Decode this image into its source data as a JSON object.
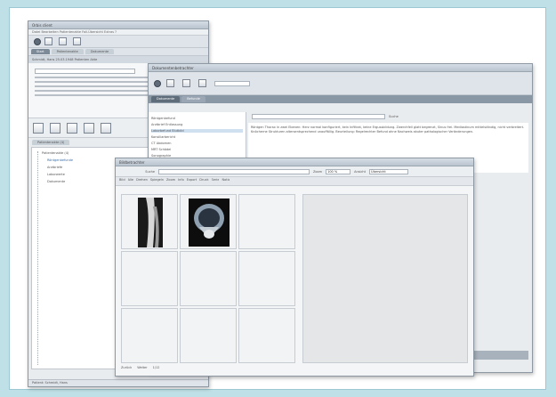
{
  "back_window": {
    "title": "Orbis client",
    "menu": "Datei   Bearbeiten   Patientenakte   Fall-Übersicht   Extras   ?",
    "tabs": [
      "Start",
      "Patientenakte",
      "Dokumente"
    ],
    "patient_header": "Schmidt, Hans  25.03.1948  Patienten Akte",
    "tree_items": [
      "Patientenakte (4)",
      "Röntgenbefunde",
      "Arztbriefe",
      "Laborwerte",
      "Dokumente"
    ],
    "status": "Patient: Schmidt, Hans"
  },
  "mid_window": {
    "title": "Dokumentenbetrachter",
    "tabs": [
      "Dokumente",
      "Befunde"
    ],
    "search_value": "Suche",
    "list_items": [
      "Röntgenbefund",
      "Arztbrief Entlassung",
      "Laborbefund Blutbild",
      "Konsiliarbericht",
      "CT Abdomen",
      "MRT Schädel",
      "Sonographie"
    ],
    "body_text": "Röntgen Thorax in zwei Ebenen: Herz normal konfiguriert, kein Infiltrat, keine Ergussbildung. Zwerchfell glatt begrenzt, Sinus frei. Mediastinum mittelständig, nicht verbreitert. Knöcherne Strukturen altersentsprechend unauffällig. Beurteilung: Regelrechter Befund ohne Nachweis akuter pathologischer Veränderungen."
  },
  "front_window": {
    "title": "Bildbetrachter",
    "search_label": "Suche",
    "zoom_label": "Zoom",
    "zoom_value": "100 %",
    "view_label": "Ansicht",
    "view_value": "Übersicht",
    "toolbar_items": [
      "Bild",
      "Alle",
      "Drehen",
      "Spiegeln",
      "Zoom",
      "Info",
      "Export",
      "Druck",
      "Serie",
      "Notiz"
    ],
    "footer_items": [
      "Zurück",
      "Weiter",
      "1/12"
    ],
    "images": [
      "xray-leg",
      "xray-skull"
    ]
  }
}
